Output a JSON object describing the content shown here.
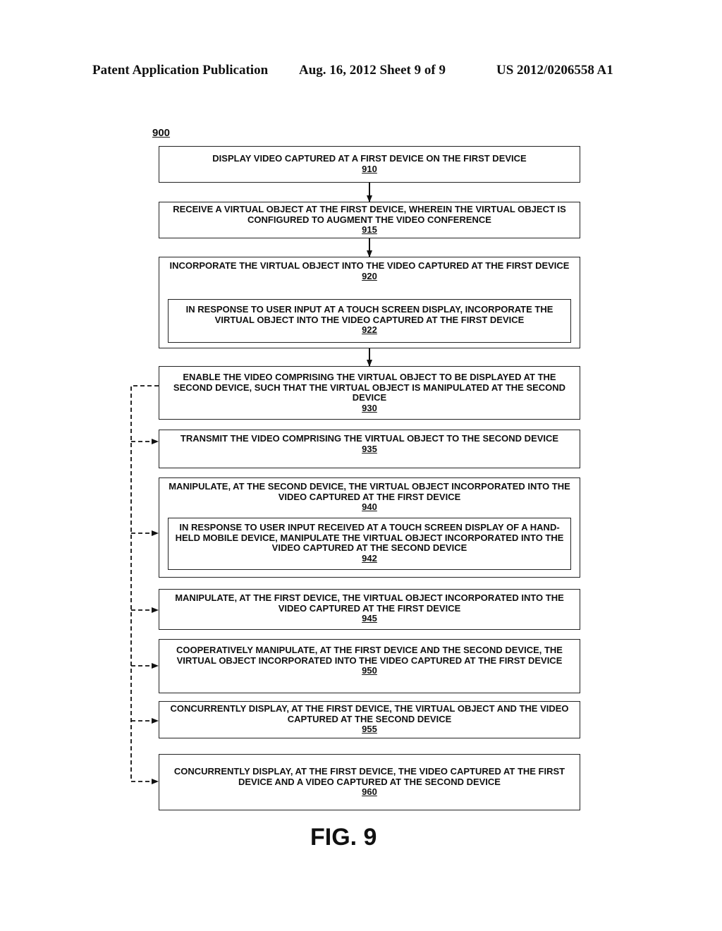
{
  "header": {
    "left": "Patent Application Publication",
    "center": "Aug. 16, 2012  Sheet 9 of 9",
    "right": "US 2012/0206558 A1"
  },
  "diagram": {
    "label": "900",
    "steps": [
      {
        "id": "910",
        "text": "DISPLAY VIDEO CAPTURED AT A FIRST DEVICE ON THE FIRST DEVICE"
      },
      {
        "id": "915",
        "text": "RECEIVE A VIRTUAL OBJECT AT THE FIRST DEVICE, WHEREIN THE VIRTUAL OBJECT IS CONFIGURED TO AUGMENT THE VIDEO CONFERENCE"
      },
      {
        "id": "920",
        "text": "INCORPORATE THE VIRTUAL OBJECT INTO THE VIDEO CAPTURED AT THE FIRST DEVICE",
        "sub": {
          "id": "922",
          "text": "IN RESPONSE TO USER INPUT AT A TOUCH SCREEN DISPLAY, INCORPORATE THE VIRTUAL OBJECT INTO THE VIDEO CAPTURED AT THE FIRST DEVICE"
        }
      },
      {
        "id": "930",
        "text": "ENABLE THE VIDEO COMPRISING THE VIRTUAL OBJECT TO BE DISPLAYED AT THE SECOND DEVICE, SUCH THAT THE VIRTUAL OBJECT IS MANIPULATED AT THE SECOND DEVICE"
      },
      {
        "id": "935",
        "text": "TRANSMIT THE VIDEO COMPRISING THE VIRTUAL OBJECT TO THE SECOND DEVICE"
      },
      {
        "id": "940",
        "text": "MANIPULATE, AT THE SECOND DEVICE, THE VIRTUAL OBJECT INCORPORATED INTO THE VIDEO CAPTURED AT THE FIRST DEVICE",
        "sub": {
          "id": "942",
          "text": "IN RESPONSE TO USER INPUT RECEIVED AT A TOUCH SCREEN DISPLAY OF A HAND-HELD MOBILE DEVICE, MANIPULATE THE VIRTUAL OBJECT INCORPORATED INTO THE VIDEO CAPTURED AT THE SECOND DEVICE"
        }
      },
      {
        "id": "945",
        "text": "MANIPULATE, AT THE FIRST  DEVICE, THE VIRTUAL OBJECT INCORPORATED INTO THE VIDEO CAPTURED AT THE FIRST DEVICE"
      },
      {
        "id": "950",
        "text": "COOPERATIVELY MANIPULATE, AT THE FIRST DEVICE AND THE SECOND DEVICE, THE VIRTUAL OBJECT INCORPORATED INTO THE VIDEO CAPTURED AT THE FIRST DEVICE"
      },
      {
        "id": "955",
        "text": "CONCURRENTLY DISPLAY, AT THE FIRST DEVICE, THE VIRTUAL OBJECT AND THE VIDEO CAPTURED AT THE SECOND DEVICE"
      },
      {
        "id": "960",
        "text": "CONCURRENTLY DISPLAY, AT THE FIRST DEVICE, THE VIDEO CAPTURED AT THE FIRST DEVICE AND A VIDEO CAPTURED AT THE SECOND DEVICE"
      }
    ],
    "figure_caption": "FIG. 9"
  }
}
